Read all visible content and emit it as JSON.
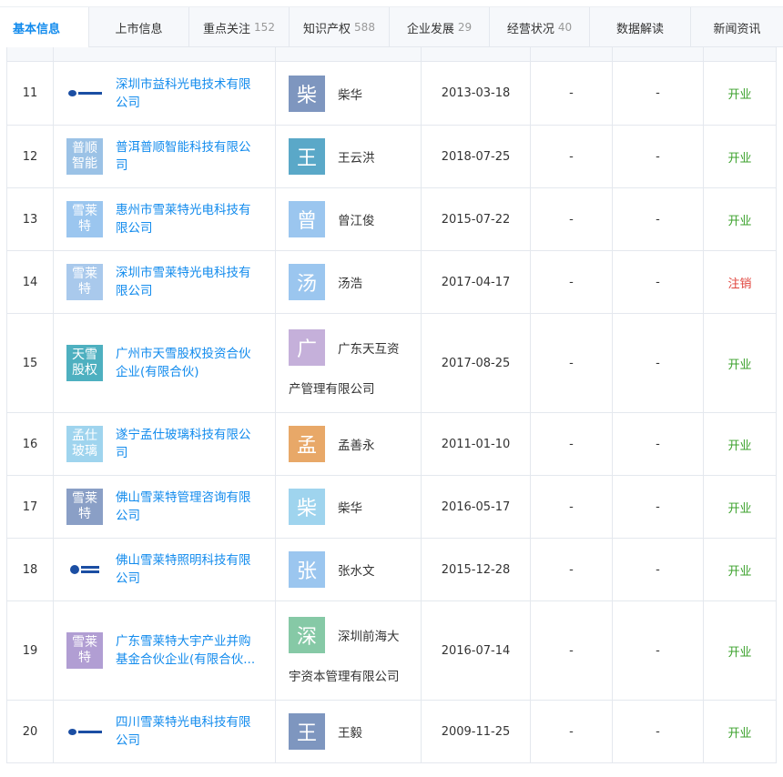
{
  "tabs": [
    {
      "label": "基本信息",
      "count": "",
      "active": true
    },
    {
      "label": "上市信息",
      "count": ""
    },
    {
      "label": "重点关注",
      "count": "152"
    },
    {
      "label": "知识产权",
      "count": "588"
    },
    {
      "label": "企业发展",
      "count": "29"
    },
    {
      "label": "经营状况",
      "count": "40"
    },
    {
      "label": "数据解读",
      "count": ""
    },
    {
      "label": "新闻资讯",
      "count": ""
    }
  ],
  "colors": {
    "link": "#128bed",
    "status_open": "#3ca22d",
    "status_cancel": "#e0443c"
  },
  "rows": [
    {
      "index": "11",
      "logo_type": "image-mark",
      "logo_text": "",
      "company": "深圳市益科光电技术有限公司",
      "avatar_char": "柴",
      "avatar_color": "#7e96bf",
      "person": "柴华",
      "person_cont": "",
      "date": "2013-03-18",
      "d1": "-",
      "d2": "-",
      "status": "开业",
      "status_color": "#3ca22d",
      "height": 70
    },
    {
      "index": "12",
      "logo_type": "text",
      "logo_text": "普顺智能",
      "logo_color": "#9bc2e6",
      "company": "普洱普顺智能科技有限公司",
      "avatar_char": "王",
      "avatar_color": "#5aa8c8",
      "person": "王云洪",
      "person_cont": "",
      "date": "2018-07-25",
      "d1": "-",
      "d2": "-",
      "status": "开业",
      "status_color": "#3ca22d",
      "height": 69
    },
    {
      "index": "13",
      "logo_type": "text",
      "logo_text": "雪莱特",
      "logo_color": "#9bc6ef",
      "company": "惠州市雪莱特光电科技有限公司",
      "avatar_char": "曾",
      "avatar_color": "#9bc6ef",
      "person": "曾江俊",
      "person_cont": "",
      "date": "2015-07-22",
      "d1": "-",
      "d2": "-",
      "status": "开业",
      "status_color": "#3ca22d",
      "height": 69
    },
    {
      "index": "14",
      "logo_type": "text",
      "logo_text": "雪莱特",
      "logo_color": "#a9c9ec",
      "company": "深圳市雪莱特光电科技有限公司",
      "avatar_char": "汤",
      "avatar_color": "#9bc6ef",
      "person": "汤浩",
      "person_cont": "",
      "date": "2017-04-17",
      "d1": "-",
      "d2": "-",
      "status": "注销",
      "status_color": "#e0443c",
      "height": 69
    },
    {
      "index": "15",
      "logo_type": "text",
      "logo_text": "天雪股权",
      "logo_color": "#4eb0c0",
      "company": "广州市天雪股权投资合伙企业(有限合伙)",
      "avatar_char": "广",
      "avatar_color": "#c5b0da",
      "person": "广东天互资",
      "person_cont": "产管理有限公司",
      "date": "2017-08-25",
      "d1": "-",
      "d2": "-",
      "status": "开业",
      "status_color": "#3ca22d",
      "height": 109
    },
    {
      "index": "16",
      "logo_type": "text",
      "logo_text": "孟仕玻璃",
      "logo_color": "#9fd4ee",
      "company": "遂宁孟仕玻璃科技有限公司",
      "avatar_char": "孟",
      "avatar_color": "#e8a868",
      "person": "孟善永",
      "person_cont": "",
      "date": "2011-01-10",
      "d1": "-",
      "d2": "-",
      "status": "开业",
      "status_color": "#3ca22d",
      "height": 69
    },
    {
      "index": "17",
      "logo_type": "text",
      "logo_text": "雪莱特",
      "logo_color": "#8a9fc6",
      "company": "佛山雪莱特管理咨询有限公司",
      "avatar_char": "柴",
      "avatar_color": "#9fd4ee",
      "person": "柴华",
      "person_cont": "",
      "date": "2016-05-17",
      "d1": "-",
      "d2": "-",
      "status": "开业",
      "status_color": "#3ca22d",
      "height": 69
    },
    {
      "index": "18",
      "logo_type": "image-ball",
      "logo_text": "",
      "company": "佛山雪莱特照明科技有限公司",
      "avatar_char": "张",
      "avatar_color": "#9bc6ef",
      "person": "张水文",
      "person_cont": "",
      "date": "2015-12-28",
      "d1": "-",
      "d2": "-",
      "status": "开业",
      "status_color": "#3ca22d",
      "height": 69
    },
    {
      "index": "19",
      "logo_type": "text",
      "logo_text": "雪莱特",
      "logo_color": "#b19ed3",
      "company": "广东雪莱特大宇产业并购基金合伙企业(有限合伙...",
      "avatar_char": "深",
      "avatar_color": "#86c9a6",
      "person": "深圳前海大",
      "person_cont": "宇资本管理有限公司",
      "date": "2016-07-14",
      "d1": "-",
      "d2": "-",
      "status": "开业",
      "status_color": "#3ca22d",
      "height": 109
    },
    {
      "index": "20",
      "logo_type": "image-mark",
      "logo_text": "",
      "company": "四川雪莱特光电科技有限公司",
      "avatar_char": "王",
      "avatar_color": "#7e96bf",
      "person": "王毅",
      "person_cont": "",
      "date": "2009-11-25",
      "d1": "-",
      "d2": "-",
      "status": "开业",
      "status_color": "#3ca22d",
      "height": 69
    }
  ]
}
